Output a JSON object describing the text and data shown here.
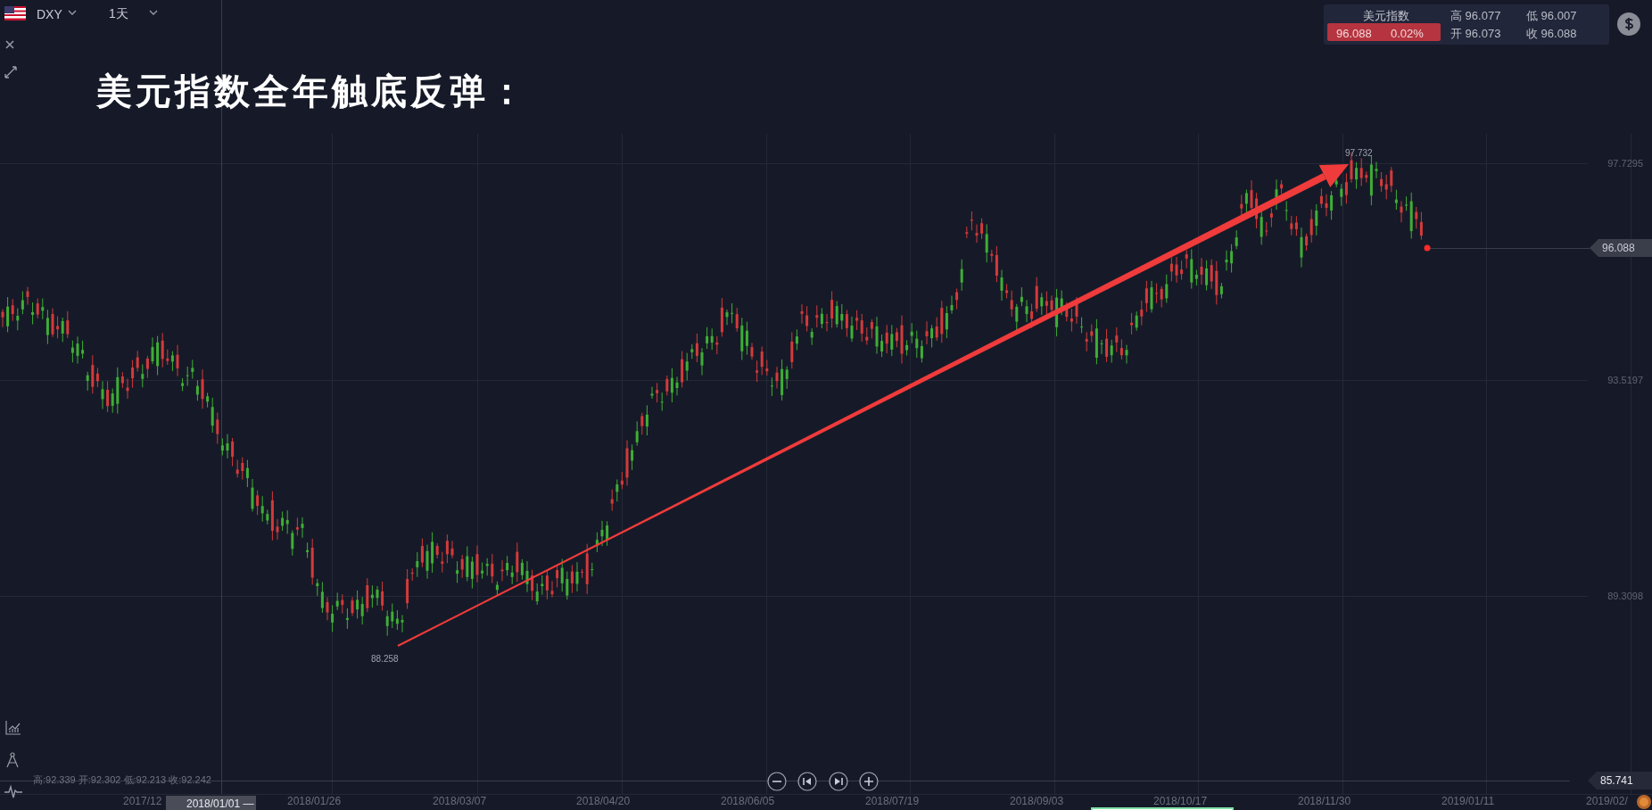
{
  "toolbar": {
    "symbol": "DXY",
    "interval": "1天"
  },
  "title": "美元指数全年触底反弹：",
  "quote_panel": {
    "name": "美元指数",
    "price": "96.088",
    "change": "0.02%",
    "high": "高 96.077",
    "low": "低 96.007",
    "open": "开 96.073",
    "close": "收 96.088"
  },
  "chart": {
    "y_axis_labels": [
      "97.7295",
      "93.5197",
      "89.3098"
    ],
    "last_price_tag": "96.088",
    "crosshair_price_tag": "85.741",
    "annotations": [
      {
        "text": "97.732"
      },
      {
        "text": "88.258"
      }
    ],
    "crosshair_ohlc": "高:92.339 开:92.302 低:92.213 收:92.242",
    "crosshair_date": "2018/01/01 —",
    "x_axis_labels": [
      "2017/12",
      "2018/01/26",
      "2018/03/07",
      "2018/04/20",
      "2018/06/05",
      "2018/07/19",
      "2018/09/03",
      "2018/10/17",
      "2018/11/30",
      "2019/01/11",
      "2019/02/"
    ]
  }
}
